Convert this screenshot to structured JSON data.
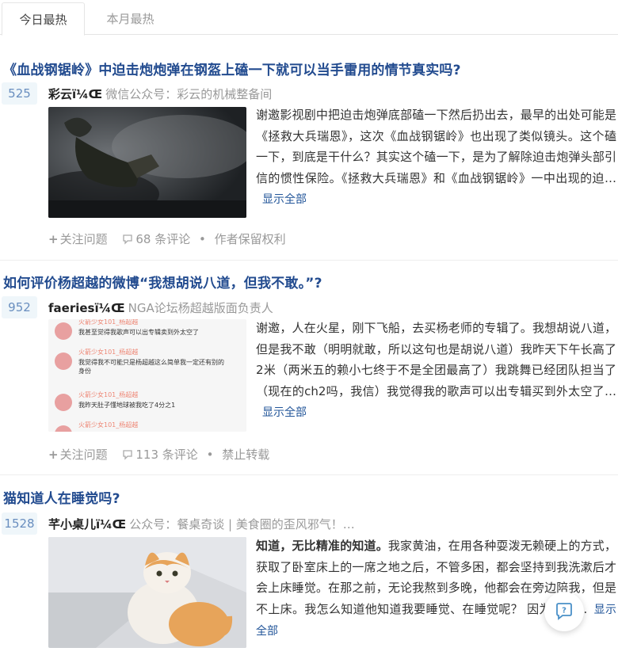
{
  "tabs": [
    {
      "label": "今日最热",
      "active": true
    },
    {
      "label": "本月最热",
      "active": false
    }
  ],
  "items": [
    {
      "title": "《血战钢锯岭》中迫击炮炮弹在钢盔上磕一下就可以当手雷用的情节真实吗?",
      "votes": "525",
      "author": "彩云ï¼Œ",
      "bio": "微信公众号：彩云的机械整备间",
      "bold_lead": "",
      "summary": "谢邀影视剧中把迫击炮弹底部磕一下然后扔出去，最早的出处可能是《拯救大兵瑞恩》，这次《血战钢锯岭》也出现了类似镜头。这个磕一下，到底是干什么？其实这个磕一下，是为了解除迫击炮弹头部引信的惯性保险。《拯救大兵瑞恩》和《血战钢锯岭》一中出现的迫…",
      "show_all": "显示全部",
      "follow": "关注问题",
      "comments": "68 条评论",
      "rights": "作者保留权利"
    },
    {
      "title": "如何评价杨超越的微博“我想胡说八道，但我不敢。”?",
      "votes": "952",
      "author": "faeriesï¼Œ",
      "bio": "NGA论坛杨超越版面负责人",
      "bold_lead": "",
      "summary": "谢邀，人在火星，刚下飞船，去买杨老师的专辑了。我想胡说八道，但是我不敢（明明就敢，所以这句也是胡说八道）我昨天下午长高了2米（两米五的赖小七终于不是全团最高了）我跳舞已经团队担当了 （现在的ch2吗，我信）我觉得我的歌声可以出专辑买到外太空了…",
      "show_all": "显示全部",
      "follow": "关注问题",
      "comments": "113 条评论",
      "rights": "禁止转载",
      "thumb_comments": [
        {
          "user": "火箭少女101_杨超越",
          "text": "我甚至觉得我歌声可以出专辑卖到外太空了"
        },
        {
          "user": "火箭少女101_杨超越",
          "text": "我觉得我不可能只是杨超越这么简单我一定还有别的身份"
        },
        {
          "user": "火箭少女101_杨超越",
          "text": "我昨天肚子懂地球被我吃了4分之1"
        },
        {
          "user": "火箭少女101_杨超越",
          "text": ""
        }
      ]
    },
    {
      "title": "猫知道人在睡觉吗?",
      "votes": "1528",
      "author": "芊小桌儿ï¼Œ",
      "bio": "公众号：餐桌奇谈 | 美食圈的歪风邪气！…",
      "bold_lead": "知道，无比精准的知道。",
      "summary": "我家黄油，在用各种耍泼无赖硬上的方式，获取了卧室床上的一席之地之后，不管多困，都会坚持到我洗漱后才会上床睡觉。在那之前，无论我熬到多晚，他都会在旁边陪我，但是不上床。我怎么知道他知道我要睡觉、在睡觉呢？ 因为当我…",
      "show_all": "显示全部"
    }
  ],
  "colors": {
    "title": "#224b8f",
    "vote_bg": "#eff6fa",
    "vote_text": "#698ebf",
    "link": "#225599",
    "muted": "#999999"
  },
  "icons": [
    "plus-icon",
    "comment-icon",
    "help-chat-icon"
  ]
}
